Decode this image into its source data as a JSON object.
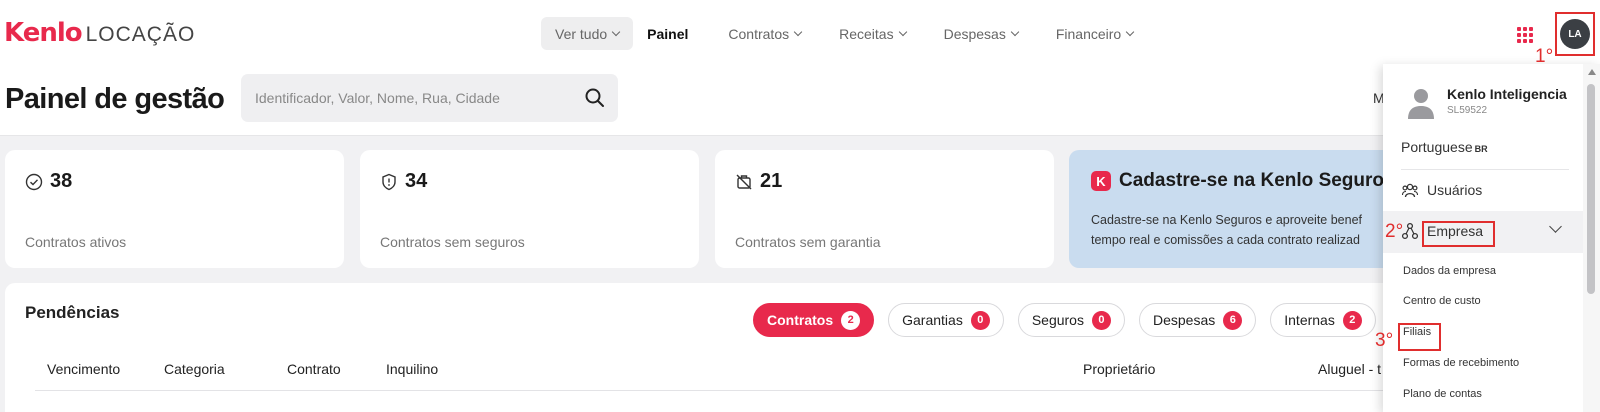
{
  "header": {
    "logo_brand": "Kenlo",
    "logo_product": "LOCAÇÃO",
    "nav": [
      {
        "label": "Ver tudo"
      },
      {
        "label": "Painel"
      },
      {
        "label": "Contratos"
      },
      {
        "label": "Receitas"
      },
      {
        "label": "Despesas"
      },
      {
        "label": "Financeiro"
      }
    ],
    "avatar_initials": "LA"
  },
  "annotations": {
    "step1": "1°",
    "step2": "2°",
    "step3": "3°"
  },
  "page": {
    "title": "Painel de gestão",
    "search_placeholder": "Identificador, Valor, Nome, Rua, Cidade",
    "cut_text": "M"
  },
  "stats": [
    {
      "value": "38",
      "label": "Contratos ativos",
      "icon": "check-circle-icon"
    },
    {
      "value": "34",
      "label": "Contratos sem seguros",
      "icon": "shield-icon"
    },
    {
      "value": "21",
      "label": "Contratos sem garantia",
      "icon": "no-guarantee-icon"
    }
  ],
  "promo": {
    "title": "Cadastre-se na Kenlo Seguros",
    "line1": "Cadastre-se na Kenlo Seguros e aproveite benef",
    "line2": "tempo real e comissões a cada contrato realizad"
  },
  "pendencias": {
    "title": "Pendências",
    "chips": [
      {
        "label": "Contratos",
        "count": "2"
      },
      {
        "label": "Garantias",
        "count": "0"
      },
      {
        "label": "Seguros",
        "count": "0"
      },
      {
        "label": "Despesas",
        "count": "6"
      },
      {
        "label": "Internas",
        "count": "2"
      }
    ],
    "columns": [
      "Vencimento",
      "Categoria",
      "Contrato",
      "Inquilino",
      "Proprietário",
      "Aluguel - t"
    ]
  },
  "menu": {
    "user_name": "Kenlo Inteligencia",
    "user_id": "SL59522",
    "language": "Portuguese",
    "language_code": "BR",
    "usuarios": "Usuários",
    "empresa": "Empresa",
    "sub_items": [
      "Dados da empresa",
      "Centro de custo",
      "Filiais",
      "Formas de recebimento",
      "Plano de contas"
    ]
  },
  "colors": {
    "accent": "#e8294c",
    "annotation": "#e02e2e",
    "promo_bg": "#c9dcef"
  }
}
